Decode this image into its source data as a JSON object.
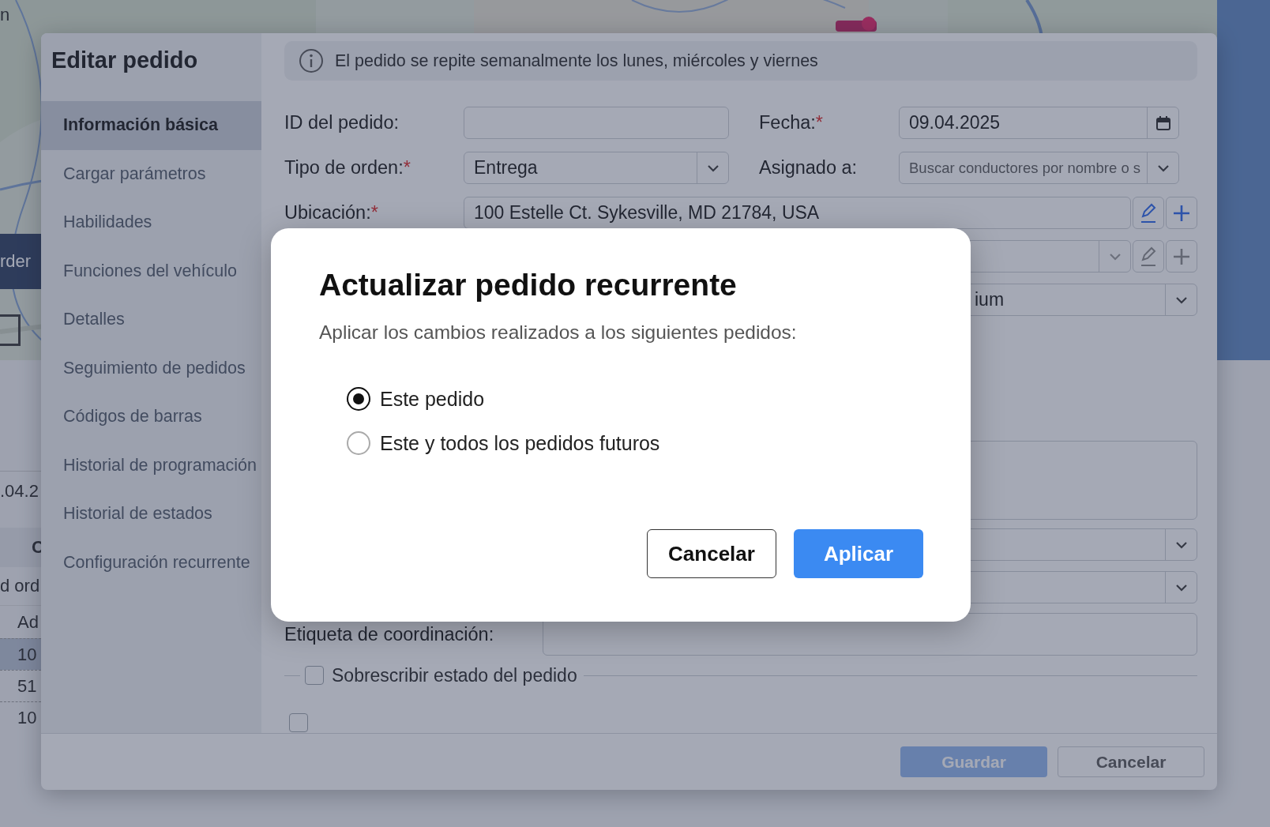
{
  "background": {
    "fragments": [
      {
        "kind": "map_label",
        "text": "n"
      },
      {
        "kind": "dark_button",
        "text": "rder"
      },
      {
        "kind": "date",
        "text": ".04.2"
      },
      {
        "kind": "header",
        "text": "C"
      },
      {
        "kind": "caption",
        "text": "d ord"
      },
      {
        "kind": "column",
        "text": "Ad"
      },
      {
        "kind": "row",
        "text": "10",
        "selected": true
      },
      {
        "kind": "row",
        "text": "51",
        "selected": false
      },
      {
        "kind": "row",
        "text": "10",
        "selected": false
      }
    ]
  },
  "editor": {
    "title": "Editar pedido",
    "sidebar": [
      {
        "label": "Información básica",
        "selected": true
      },
      {
        "label": "Cargar parámetros",
        "selected": false
      },
      {
        "label": "Habilidades",
        "selected": false
      },
      {
        "label": "Funciones del vehículo",
        "selected": false
      },
      {
        "label": "Detalles",
        "selected": false
      },
      {
        "label": "Seguimiento de pedidos",
        "selected": false
      },
      {
        "label": "Códigos de barras",
        "selected": false
      },
      {
        "label": "Historial de programación",
        "selected": false
      },
      {
        "label": "Historial de estados",
        "selected": false
      },
      {
        "label": "Configuración recurrente",
        "selected": false
      }
    ],
    "banner": "El pedido se repite semanalmente los lunes, miércoles y viernes",
    "rows": [
      {
        "kind": "pair",
        "fields": [
          {
            "label": "ID del pedido:",
            "kind": "text"
          },
          {
            "label": "Fecha:",
            "required_mark": "*",
            "kind": "date",
            "value": "09.04.2025"
          }
        ]
      },
      {
        "kind": "pair",
        "fields": [
          {
            "label": "Tipo de orden:",
            "required_mark": "*",
            "kind": "select",
            "value": "Entrega"
          },
          {
            "label": "Asignado a:",
            "kind": "select",
            "placeholder": "Buscar conductores por nombre o s"
          }
        ]
      },
      {
        "kind": "location",
        "label": "Ubicación:",
        "required_mark": "*",
        "value": "100 Estelle Ct. Sykesville, MD 21784, USA",
        "disabled": false
      },
      {
        "kind": "location",
        "disabled": true
      },
      {
        "kind": "select",
        "value": "ium"
      },
      {
        "kind": "spacer"
      },
      {
        "kind": "textarea"
      },
      {
        "kind": "select"
      },
      {
        "kind": "select"
      },
      {
        "kind": "text",
        "label": "Etiqueta de coordinación:"
      },
      {
        "kind": "checkbox",
        "label": "Sobrescribir estado del pedido",
        "checked": false
      },
      {
        "kind": "checkbox",
        "checked": false
      }
    ],
    "footer_buttons": [
      {
        "label": "Guardar",
        "kind": "primary",
        "disabled": true
      },
      {
        "label": "Cancelar",
        "kind": "secondary",
        "disabled": false
      }
    ]
  },
  "dialog": {
    "title": "Actualizar pedido recurrente",
    "subtitle": "Aplicar los cambios realizados a los siguientes pedidos:",
    "options": [
      {
        "label": "Este pedido",
        "selected": true
      },
      {
        "label": "Este y todos los pedidos futuros",
        "selected": false
      }
    ],
    "buttons": [
      {
        "label": "Cancelar",
        "kind": "secondary"
      },
      {
        "label": "Aplicar",
        "kind": "primary"
      }
    ]
  }
}
